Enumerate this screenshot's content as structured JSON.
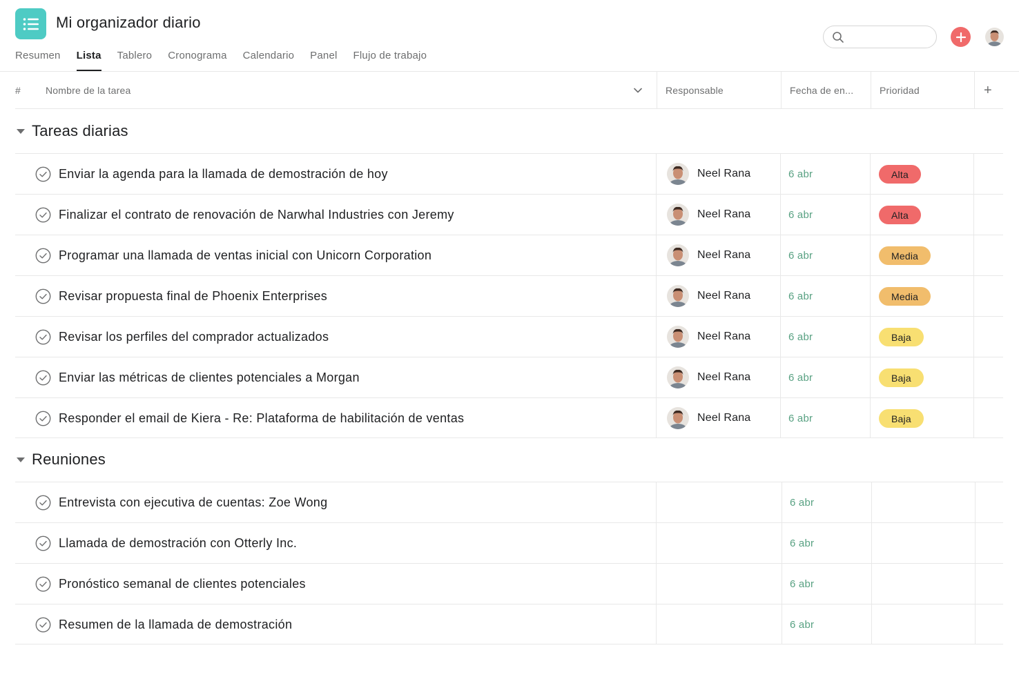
{
  "app": {
    "title": "Mi organizador diario",
    "icon": "list-icon",
    "accent": "#4ecbc4"
  },
  "tabs": [
    {
      "label": "Resumen",
      "active": false
    },
    {
      "label": "Lista",
      "active": true
    },
    {
      "label": "Tablero",
      "active": false
    },
    {
      "label": "Cronograma",
      "active": false
    },
    {
      "label": "Calendario",
      "active": false
    },
    {
      "label": "Panel",
      "active": false
    },
    {
      "label": "Flujo de trabajo",
      "active": false
    }
  ],
  "search": {
    "placeholder": "",
    "value": ""
  },
  "columns": {
    "index": "#",
    "name": "Nombre de la tarea",
    "assignee": "Responsable",
    "due": "Fecha de en...",
    "priority": "Prioridad",
    "add": "+"
  },
  "sections": [
    {
      "title": "Tareas diarias",
      "tasks": [
        {
          "name": "Enviar la agenda para la llamada de demostración de hoy",
          "assignee": "Neel Rana",
          "due": "6 abr",
          "priority": "Alta"
        },
        {
          "name": "Finalizar el contrato de renovación de Narwhal Industries con Jeremy",
          "assignee": "Neel Rana",
          "due": "6 abr",
          "priority": "Alta"
        },
        {
          "name": "Programar una llamada de ventas inicial con Unicorn Corporation",
          "assignee": "Neel Rana",
          "due": "6 abr",
          "priority": "Media"
        },
        {
          "name": "Revisar propuesta final de Phoenix Enterprises",
          "assignee": "Neel Rana",
          "due": "6 abr",
          "priority": "Media"
        },
        {
          "name": "Revisar los perfiles del comprador actualizados",
          "assignee": "Neel Rana",
          "due": "6 abr",
          "priority": "Baja"
        },
        {
          "name": "Enviar las métricas de clientes potenciales a Morgan",
          "assignee": "Neel Rana",
          "due": "6 abr",
          "priority": "Baja"
        },
        {
          "name": "Responder el email de Kiera - Re: Plataforma de habilitación de ventas",
          "assignee": "Neel Rana",
          "due": "6 abr",
          "priority": "Baja"
        }
      ]
    },
    {
      "title": "Reuniones",
      "tasks": [
        {
          "name": "Entrevista con ejecutiva de cuentas: Zoe Wong",
          "due": "6 abr"
        },
        {
          "name": "Llamada de demostración con Otterly Inc.",
          "due": "6 abr"
        },
        {
          "name": "Pronóstico semanal de clientes potenciales",
          "due": "6 abr"
        },
        {
          "name": "Resumen de la llamada de demostración",
          "due": "6 abr"
        }
      ]
    }
  ],
  "priority_colors": {
    "Alta": "#f06a6a",
    "Media": "#f1bd6c",
    "Baja": "#f8df72"
  },
  "date_color": "#58a182"
}
